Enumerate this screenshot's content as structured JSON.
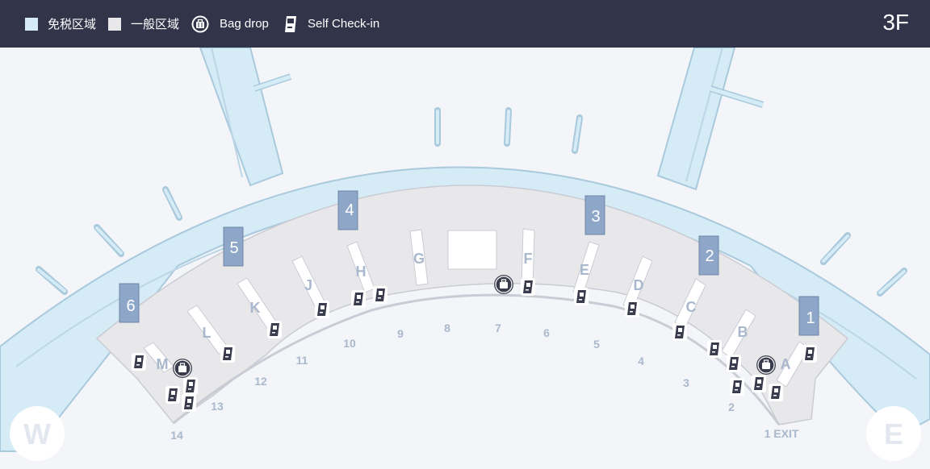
{
  "header": {
    "legend": [
      {
        "label": "免税区域",
        "color": "#d5ebf6"
      },
      {
        "label": "一般区域",
        "color": "#e8e8ea"
      },
      {
        "label": "Bag drop",
        "icon": "bag-drop-icon"
      },
      {
        "label": "Self Check-in",
        "icon": "self-checkin-icon"
      }
    ],
    "floor": "3F"
  },
  "gates": {
    "g1": "1",
    "g2": "2",
    "g3": "3",
    "g4": "4",
    "g5": "5",
    "g6": "6"
  },
  "counters": {
    "A": "A",
    "B": "B",
    "C": "C",
    "D": "D",
    "E": "E",
    "F": "F",
    "G": "G",
    "H": "H",
    "J": "J",
    "K": "K",
    "L": "L",
    "M": "M"
  },
  "entrances": {
    "e1": "1 EXIT",
    "e2": "2",
    "e3": "3",
    "e4": "4",
    "e5": "5",
    "e6": "6",
    "e7": "7",
    "e8": "8",
    "e9": "9",
    "e10": "10",
    "e11": "11",
    "e12": "12",
    "e13": "13",
    "e14": "14"
  },
  "compass": {
    "west": "W",
    "east": "E"
  },
  "colors": {
    "header_bg": "#32344a",
    "duty_free": "#d5ebf6",
    "general": "#e8e8ea",
    "gate_block": "#8ea7c9",
    "label": "#a9b8cc"
  }
}
